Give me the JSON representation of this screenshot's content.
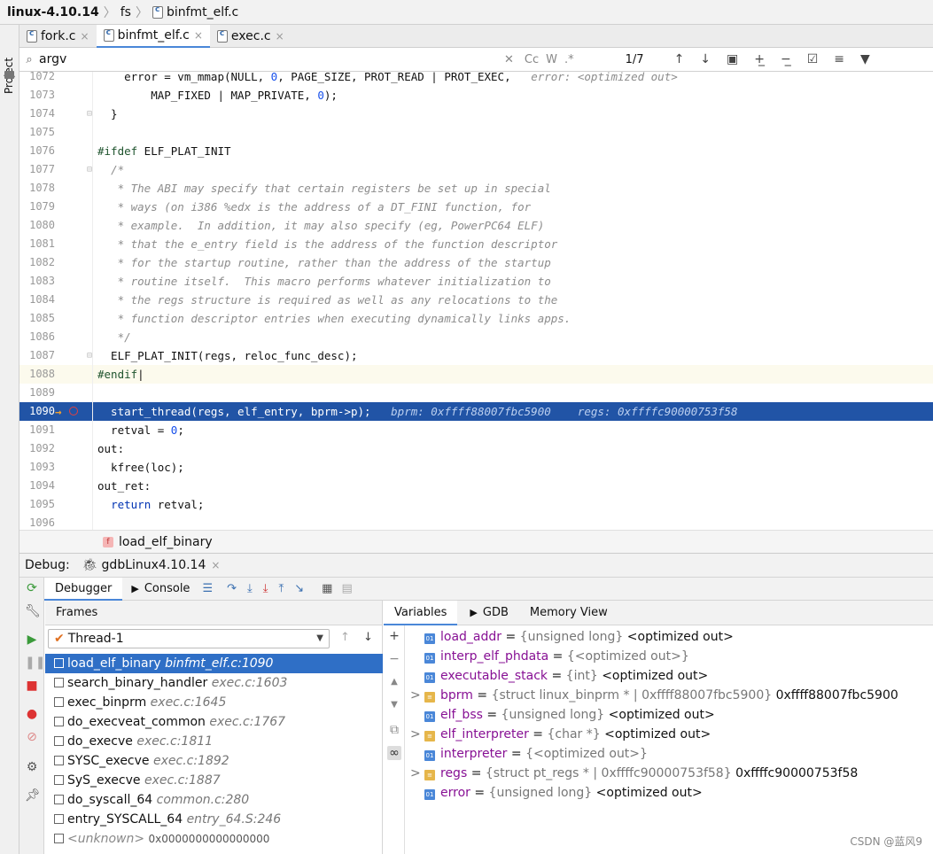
{
  "breadcrumb": {
    "project": "linux-4.10.14",
    "folder": "fs",
    "file": "binfmt_elf.c"
  },
  "sidebar": {
    "project_label": "Project"
  },
  "tabs": [
    {
      "label": "fork.c",
      "close": "×"
    },
    {
      "label": "binfmt_elf.c",
      "close": "×"
    },
    {
      "label": "exec.c",
      "close": "×"
    }
  ],
  "search": {
    "value": "argv",
    "case_label": "Cc",
    "word_label": "W",
    "regex_label": ".*",
    "match_count": "1/7"
  },
  "editor": {
    "lines": [
      {
        "n": "1072",
        "html": "    error = vm_mmap(NULL, <span class=\"num\">0</span>, PAGE_SIZE, PROT_READ | PROT_EXEC,   <span class=\"hint\">error: &lt;optimized out&gt;</span>"
      },
      {
        "n": "1073",
        "html": "        MAP_FIXED | MAP_PRIVATE, <span class=\"num\">0</span>);"
      },
      {
        "n": "1074",
        "html": "  }"
      },
      {
        "n": "1075",
        "html": ""
      },
      {
        "n": "1076",
        "html": "<span class=\"pp\">#ifdef</span> ELF_PLAT_INIT"
      },
      {
        "n": "1077",
        "html": "  <span class=\"cm\">/*</span>"
      },
      {
        "n": "1078",
        "html": "<span class=\"cm\">   * The ABI may specify that certain registers be set up in special</span>"
      },
      {
        "n": "1079",
        "html": "<span class=\"cm\">   * ways (on i386 %edx is the address of a DT_FINI function, for</span>"
      },
      {
        "n": "1080",
        "html": "<span class=\"cm\">   * example.  In addition, it may also specify (eg, PowerPC64 ELF)</span>"
      },
      {
        "n": "1081",
        "html": "<span class=\"cm\">   * that the e_entry field is the address of the function descriptor</span>"
      },
      {
        "n": "1082",
        "html": "<span class=\"cm\">   * for the startup routine, rather than the address of the startup</span>"
      },
      {
        "n": "1083",
        "html": "<span class=\"cm\">   * routine itself.  This macro performs whatever initialization to</span>"
      },
      {
        "n": "1084",
        "html": "<span class=\"cm\">   * the regs structure is required as well as any relocations to the</span>"
      },
      {
        "n": "1085",
        "html": "<span class=\"cm\">   * function descriptor entries when executing dynamically links apps.</span>"
      },
      {
        "n": "1086",
        "html": "<span class=\"cm\">   */</span>"
      },
      {
        "n": "1087",
        "html": "  ELF_PLAT_INIT(regs, reloc_func_desc);"
      },
      {
        "n": "1088",
        "html": "<span class=\"pp\">#endif</span>|"
      },
      {
        "n": "1089",
        "html": ""
      },
      {
        "n": "1090",
        "html": "  start_thread(regs, elf_entry, bprm-&gt;p);   <span class=\"hint\">bprm: 0xffff88007fbc5900    regs: 0xffffc90000753f58</span>"
      },
      {
        "n": "1091",
        "html": "  retval = <span class=\"num\">0</span>;"
      },
      {
        "n": "1092",
        "html": "out:"
      },
      {
        "n": "1093",
        "html": "  kfree(loc);"
      },
      {
        "n": "1094",
        "html": "out_ret:"
      },
      {
        "n": "1095",
        "html": "  <span class=\"kw\">return</span> retval;"
      },
      {
        "n": "1096",
        "html": ""
      }
    ]
  },
  "funcbar": {
    "badge": "f",
    "name": "load_elf_binary"
  },
  "debug": {
    "label": "Debug:",
    "session": "gdbLinux4.10.14",
    "close": "×"
  },
  "dbg_tabs": {
    "debugger": "Debugger",
    "console": "Console"
  },
  "frames": {
    "header": "Frames",
    "thread": "Thread-1",
    "items": [
      {
        "fn": "load_elf_binary",
        "loc": "binfmt_elf.c:1090"
      },
      {
        "fn": "search_binary_handler",
        "loc": "exec.c:1603"
      },
      {
        "fn": "exec_binprm",
        "loc": "exec.c:1645"
      },
      {
        "fn": "do_execveat_common",
        "loc": "exec.c:1767"
      },
      {
        "fn": "do_execve",
        "loc": "exec.c:1811"
      },
      {
        "fn": "SYSC_execve",
        "loc": "exec.c:1892"
      },
      {
        "fn": "SyS_execve",
        "loc": "exec.c:1887"
      },
      {
        "fn": "do_syscall_64",
        "loc": "common.c:280"
      },
      {
        "fn": "entry_SYSCALL_64",
        "loc": "entry_64.S:246"
      },
      {
        "fn": "<unknown>",
        "loc": "0x0000000000000000"
      }
    ]
  },
  "vars_tabs": {
    "variables": "Variables",
    "gdb": "GDB",
    "memory": "Memory View"
  },
  "variables": [
    {
      "expand": "",
      "badge": "01",
      "name": "load_addr",
      "type": "{unsigned long}",
      "value": "<optimized out>"
    },
    {
      "expand": "",
      "badge": "01",
      "name": "interp_elf_phdata",
      "type": "{<optimized out>}",
      "value": ""
    },
    {
      "expand": "",
      "badge": "01",
      "name": "executable_stack",
      "type": "{int}",
      "value": "<optimized out>"
    },
    {
      "expand": ">",
      "badge": "≡",
      "name": "bprm",
      "type": "{struct linux_binprm * | 0xffff88007fbc5900}",
      "value": "0xffff88007fbc5900"
    },
    {
      "expand": "",
      "badge": "01",
      "name": "elf_bss",
      "type": "{unsigned long}",
      "value": "<optimized out>"
    },
    {
      "expand": ">",
      "badge": "≡",
      "name": "elf_interpreter",
      "type": "{char *}",
      "value": "<optimized out>"
    },
    {
      "expand": "",
      "badge": "01",
      "name": "interpreter",
      "type": "{<optimized out>}",
      "value": ""
    },
    {
      "expand": ">",
      "badge": "≡",
      "name": "regs",
      "type": "{struct pt_regs * | 0xffffc90000753f58}",
      "value": "0xffffc90000753f58"
    },
    {
      "expand": "",
      "badge": "01",
      "name": "error",
      "type": "{unsigned long}",
      "value": "<optimized out>"
    }
  ],
  "watermark": "CSDN @蓝风9"
}
